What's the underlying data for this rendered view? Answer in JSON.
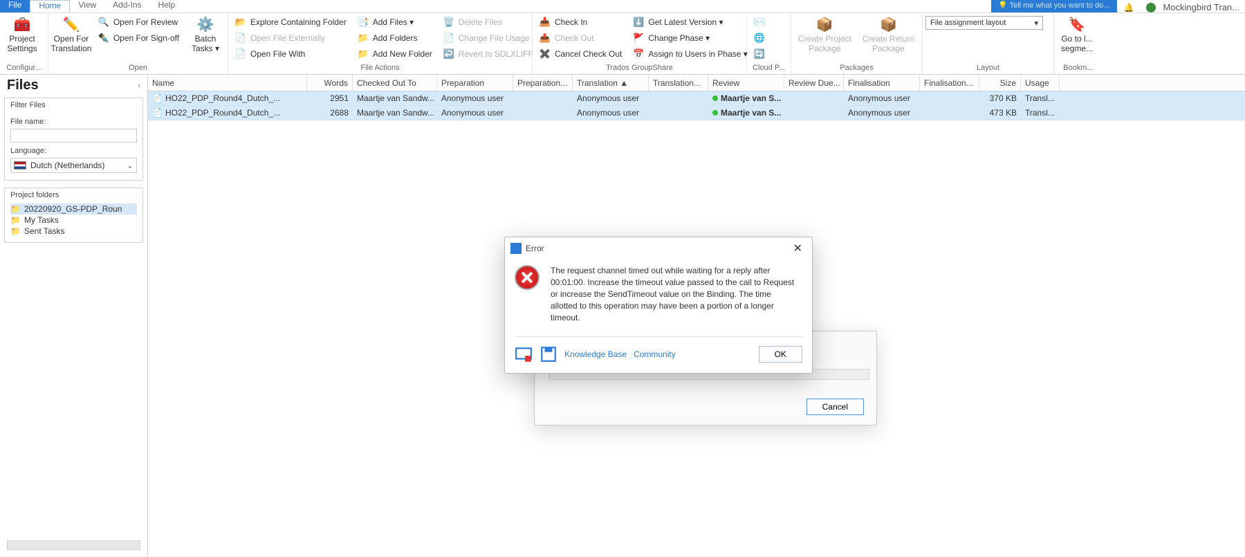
{
  "tabs": {
    "file": "File",
    "home": "Home",
    "view": "View",
    "addins": "Add-Ins",
    "help": "Help"
  },
  "tell_me": "Tell me what you want to do...",
  "user": "Mockingbird  Tran...",
  "ribbon": {
    "configuration": {
      "label": "Configur...",
      "project_settings": "Project\nSettings"
    },
    "open": {
      "label": "Open",
      "open_for_translation": "Open For\nTranslation",
      "open_for_review": "Open For Review",
      "open_for_signoff": "Open For Sign-off",
      "batch_tasks": "Batch\nTasks ▾"
    },
    "file_actions": {
      "label": "File Actions",
      "open_externally": "Open File Externally",
      "open_with": "Open File With",
      "explore_folder": "Explore Containing Folder",
      "add_files": "Add Files ▾",
      "add_folders": "Add Folders",
      "add_new_folder": "Add New Folder",
      "delete_files": "Delete Files",
      "change_file_usage": "Change File Usage",
      "revert": "Revert to SDLXLIFF"
    },
    "groupshare": {
      "label": "Trados GroupShare",
      "check_in": "Check In",
      "check_out": "Check Out",
      "cancel_check_out": "Cancel Check Out",
      "get_latest": "Get Latest Version ▾",
      "change_phase": "Change Phase ▾",
      "assign_users": "Assign to Users in Phase ▾"
    },
    "cloud": {
      "label": "Cloud  P..."
    },
    "packages": {
      "label": "Packages",
      "create_project": "Create Project\nPackage",
      "create_return": "Create Return\nPackage"
    },
    "layout": {
      "label": "Layout",
      "combo": "File assignment layout"
    },
    "bookmarks": {
      "label": "Bookm...",
      "goto": "Go to l...\nsegme..."
    }
  },
  "files_panel": {
    "title": "Files",
    "filter_hdr": "Filter Files",
    "file_name_label": "File name:",
    "language_label": "Language:",
    "language_value": "Dutch (Netherlands)",
    "project_folders_hdr": "Project folders",
    "folders": [
      {
        "name": "20220920_GS-PDP_Roun",
        "selected": true
      },
      {
        "name": "My Tasks",
        "selected": false
      },
      {
        "name": "Sent Tasks",
        "selected": false
      }
    ]
  },
  "grid": {
    "columns": [
      "Name",
      "Words",
      "Checked Out To",
      "Preparation",
      "Preparation...",
      "Translation  ▲",
      "Translation...",
      "Review",
      "Review  Due...",
      "Finalisation",
      "Finalisation...",
      "Size",
      "Usage"
    ],
    "rows": [
      {
        "name": "HO22_PDP_Round4_Dutch_...",
        "words": "2951",
        "checked_out": "Maartje  van Sandw...",
        "preparation": "Anonymous user",
        "prep2": "",
        "translation": "Anonymous user",
        "trans2": "",
        "review": "Maartje van S...",
        "review_due": "",
        "finalisation": "Anonymous user",
        "final2": "",
        "size": "370 KB",
        "usage": "Transl..."
      },
      {
        "name": "HO22_PDP_Round4_Dutch_...",
        "words": "2688",
        "checked_out": "Maartje  van Sandw...",
        "preparation": "Anonymous user",
        "prep2": "",
        "translation": "Anonymous user",
        "trans2": "",
        "review": "Maartje van S...",
        "review_due": "",
        "finalisation": "Anonymous user",
        "final2": "",
        "size": "473 KB",
        "usage": "Transl..."
      }
    ]
  },
  "bg_dialog": {
    "cancel": "Cancel"
  },
  "error_dialog": {
    "title": "Error",
    "message": "The request channel timed out while waiting for a reply after 00:01:00. Increase the timeout value passed to the call to Request or increase the SendTimeout value on the Binding. The time allotted to this operation may have been a portion of a longer timeout.",
    "kb": "Knowledge Base",
    "community": "Community",
    "ok": "OK"
  }
}
